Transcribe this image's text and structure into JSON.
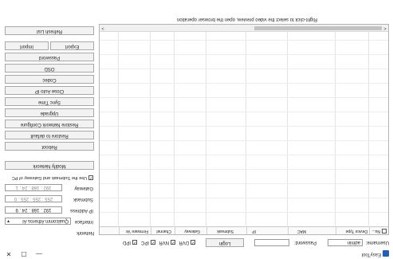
{
  "window": {
    "title": "EasyTool",
    "minimize": "—",
    "maximize": "☐",
    "close": "✕"
  },
  "toolbar": {
    "username_label": "Username:",
    "username_value": "admin",
    "password_label": "Password:",
    "password_value": "",
    "login_label": "Login",
    "filters": [
      {
        "label": "DVR",
        "checked": true
      },
      {
        "label": "NVR",
        "checked": true
      },
      {
        "label": "IPC",
        "checked": true
      },
      {
        "label": "IPD",
        "checked": true
      }
    ]
  },
  "device_table": {
    "select_all_label": "Nu...",
    "columns": [
      "Device Type",
      "MAC",
      "IP",
      "Submask",
      "Gateway",
      "Channel",
      "Firmware Ve"
    ],
    "rows": []
  },
  "hint_text": "Right-click to select the video preview, open the browser operation",
  "network_panel": {
    "title": "Network",
    "interface_label": "Interface",
    "interface_value": "Qualcomm Atheros Al",
    "ip_label": "IP Address",
    "ip_value": "192 . 168 . 24 . 9",
    "submask_label": "Submask",
    "submask_value": "255 . 255 . 255 . 0",
    "gateway_label": "Gateway",
    "gateway_value": "192 . 168 . 24 . 1",
    "use_submask_label": "Use the Submask and Gateway of PC",
    "use_submask_checked": true,
    "modify_label": "Modify Network"
  },
  "actions": {
    "reboot": "Reboot",
    "restore_default": "Restore to default",
    "restore_network": "Restore Network Configure",
    "upgrade": "Upgrade",
    "sync_time": "Sync Time",
    "close_auto_ip": "Close Auto IP",
    "codec": "Codec",
    "osd": "OSD",
    "password": "Password",
    "export": "Export",
    "import": "Import",
    "refresh_list": "Refresh List"
  },
  "scroll": {
    "left_arrow": "<",
    "right_arrow": ">"
  }
}
